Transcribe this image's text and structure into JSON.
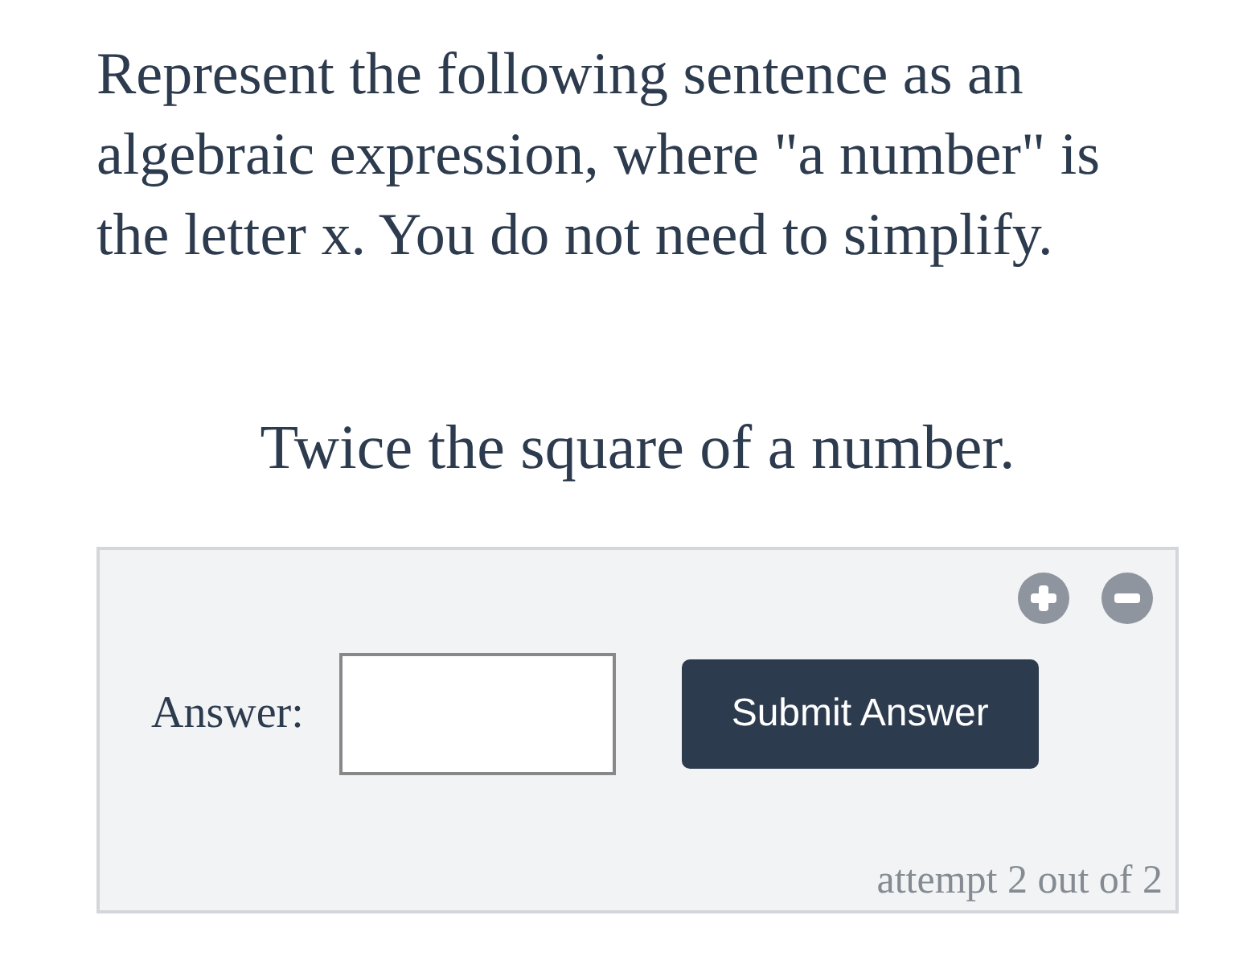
{
  "question": "Represent the following sentence as an algebraic expression, where \"a number\" is the letter x. You do not need to simplify.",
  "prompt": "Twice the square of a number.",
  "answer_panel": {
    "label": "Answer:",
    "submit": "Submit Answer",
    "attempt": "attempt 2 out of 2"
  }
}
